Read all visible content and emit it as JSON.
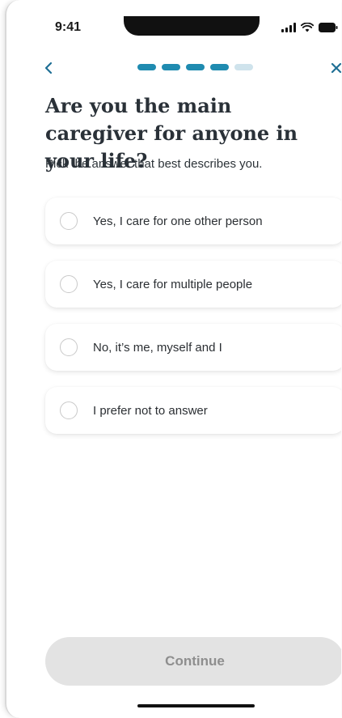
{
  "status_bar": {
    "time": "9:41",
    "icons": [
      "signal-icon",
      "wifi-icon",
      "battery-icon"
    ]
  },
  "nav": {
    "back_icon": "chevron-left-icon",
    "close_icon": "close-icon",
    "progress": {
      "total_steps": 5,
      "current_step": 4
    },
    "accent_color": "#1f8bb0"
  },
  "question": {
    "title": "Are you the main caregiver for anyone in your life?",
    "subtitle": "Pick the answer that best describes you."
  },
  "options": [
    {
      "label": "Yes, I care for one other person"
    },
    {
      "label": "Yes, I care for multiple people"
    },
    {
      "label": "No, it’s me, myself and I"
    },
    {
      "label": "I prefer not to answer"
    }
  ],
  "footer": {
    "continue_label": "Continue"
  }
}
